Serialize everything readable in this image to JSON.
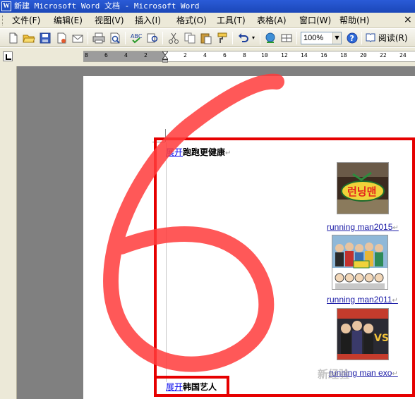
{
  "window": {
    "title": "新建 Microsoft Word 文档 - Microsoft Word",
    "app_icon": "W"
  },
  "menu": {
    "items": [
      {
        "label": "文件(F)"
      },
      {
        "label": "编辑(E)"
      },
      {
        "label": "视图(V)"
      },
      {
        "label": "插入(I)"
      },
      {
        "label": "格式(O)"
      },
      {
        "label": "工具(T)"
      },
      {
        "label": "表格(A)"
      },
      {
        "label": "窗口(W)"
      },
      {
        "label": "帮助(H)"
      }
    ],
    "close_glyph": "×"
  },
  "toolbar": {
    "buttons": [
      "new-doc-icon",
      "open-folder-icon",
      "save-icon",
      "permission-icon",
      "email-icon",
      "print-icon",
      "print-preview-icon",
      "spelling-icon",
      "research-icon",
      "cut-icon",
      "copy-icon",
      "paste-icon",
      "format-painter-icon",
      "undo-icon",
      "hyperlink-icon",
      "tables-borders-icon",
      "help-icon",
      "reading-layout-icon"
    ],
    "zoom_value": "100%",
    "read_label": "阅读(R)"
  },
  "ruler": {
    "left_numbers": [
      "8",
      "6",
      "4",
      "2"
    ],
    "right_numbers": [
      "2",
      "4",
      "6",
      "8",
      "10",
      "12",
      "14",
      "16",
      "18",
      "20",
      "22",
      "24"
    ]
  },
  "document": {
    "heading1": {
      "link": "展开",
      "text": "跑跑更健康"
    },
    "captions": [
      "running man2015",
      "running man2011",
      "running man exo"
    ],
    "heading2": {
      "link": "展开",
      "text": "韩国艺人"
    },
    "watermark": "新经验"
  },
  "annotation": {
    "stroke_color": "#ff3b3b",
    "box_color": "#e60000",
    "handwritten_digit": "6"
  }
}
